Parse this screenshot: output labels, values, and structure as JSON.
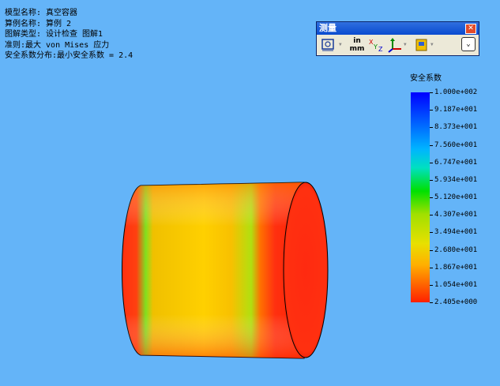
{
  "info": {
    "lines": [
      "模型名称: 真空容器",
      "算例名称: 算例 2",
      "图解类型: 设计检查 图解1",
      "准则:最大 von Mises 应力",
      "安全系数分布:最小安全系数 = 2.4"
    ]
  },
  "toolbar": {
    "title": "测量",
    "close_label": "✕",
    "units_top": "in",
    "units_bottom": "mm",
    "xyz_label": "XYZ",
    "expand_label": "⌄"
  },
  "legend": {
    "title": "安全系数",
    "labels": [
      "1.000e+002",
      "9.187e+001",
      "8.373e+001",
      "7.560e+001",
      "6.747e+001",
      "5.934e+001",
      "5.120e+001",
      "4.307e+001",
      "3.494e+001",
      "2.680e+001",
      "1.867e+001",
      "1.054e+001",
      "2.405e+000"
    ]
  },
  "colors": {
    "background": "#64b4f8",
    "legend_max": "#0000ff",
    "legend_min": "#ff2000"
  },
  "icons": [
    "measure-icon",
    "units-icon",
    "xyz-icon",
    "coordinate-icon",
    "file-icon",
    "expand-icon",
    "close-icon"
  ]
}
